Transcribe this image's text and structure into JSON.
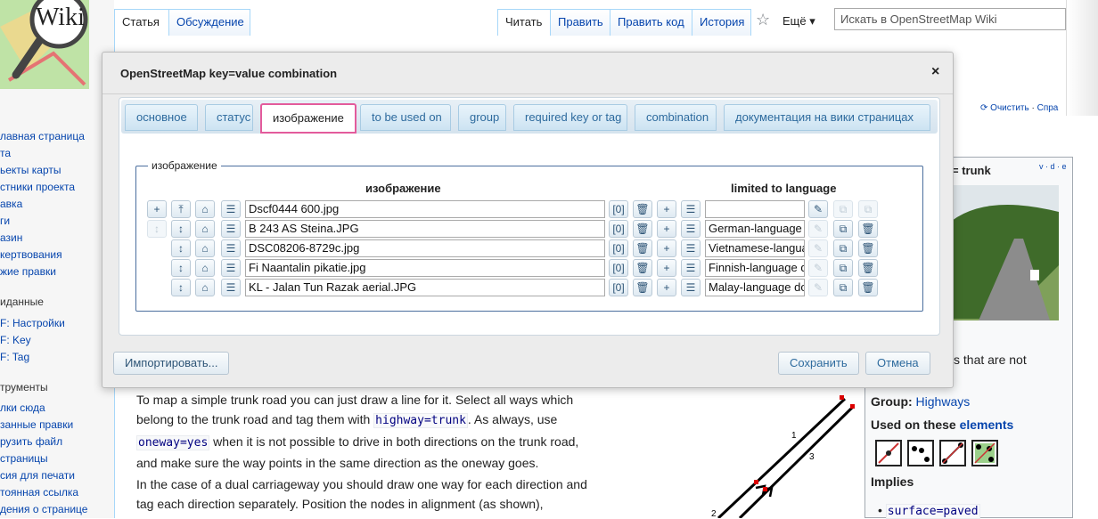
{
  "sidebar": {
    "logo_text": "Wiki",
    "nav_links": [
      "лавная страница",
      "та",
      "ьекты карты",
      "стники проекта",
      "авка",
      "ги",
      "азин",
      "кертвования",
      "жие правки"
    ],
    "section2_title": "иданные",
    "section2_links": [
      "F: Настройки",
      "F: Key",
      "F: Tag"
    ],
    "section3_title": "трументы",
    "section3_links": [
      "лки сюда",
      "занные правки",
      "рузить файл",
      "страницы",
      "сия для печати",
      "тоянная ссылка",
      "дения о странице"
    ]
  },
  "top_tabs": {
    "left": [
      "Статья",
      "Обсуждение"
    ],
    "right": [
      "Читать",
      "Править",
      "Править код",
      "История"
    ],
    "more": "Ещё"
  },
  "search": {
    "placeholder": "Искать в OpenStreetMap Wiki"
  },
  "page_tools": {
    "purge": "Очистить",
    "sep": "·",
    "help": "Спра"
  },
  "infobox": {
    "title_fragment": "= trunk",
    "vde": "v · d · e",
    "snippet": "s that are not",
    "group_label": "Group:",
    "group_value": "Highways",
    "used_on_label": "Used on these",
    "used_on_link": "elements",
    "implies_label": "Implies",
    "implies_item": "surface=paved"
  },
  "article": {
    "p1_a": "To map a simple trunk road you can just draw a line for it. Select all ways which belong to the trunk road and tag them with ",
    "p1_code1": "highway=trunk",
    "p1_b": ". As always, use ",
    "p1_code2": "oneway=yes",
    "p1_c": " when it is not possible to drive in both directions on the trunk road, and make sure the way points in the same direction as the oneway goes.",
    "p2": "In the case of a dual carriageway you should draw one way for each direction and tag each direction separately. Position the nodes in alignment (as shown),",
    "diagram_labels": [
      "1",
      "3",
      "2"
    ]
  },
  "dialog": {
    "title": "OpenStreetMap key=value combination",
    "close": "×",
    "tabs": [
      "основное",
      "статус",
      "изображение",
      "to be used on",
      "group",
      "required key or tag",
      "combination",
      "документация на вики страницах"
    ],
    "selected_tab": 2,
    "legend": "изображение",
    "col_image": "изображение",
    "col_language": "limited to language",
    "rows": [
      {
        "image": "Dscf0444 600.jpg",
        "count": "[0]",
        "language": ""
      },
      {
        "image": "B 243 AS Steina.JPG",
        "count": "[0]",
        "language": "German-language"
      },
      {
        "image": "DSC08206-8729c.jpg",
        "count": "[0]",
        "language": "Vietnamese-langua"
      },
      {
        "image": "Fi Naantalin pikatie.jpg",
        "count": "[0]",
        "language": "Finnish-language d"
      },
      {
        "image": "KL - Jalan Tun Razak aerial.JPG",
        "count": "[0]",
        "language": "Malay-language do"
      }
    ],
    "import_button": "Импортировать...",
    "save_button": "Сохранить",
    "cancel_button": "Отмена"
  },
  "icons": {
    "add": "+",
    "move_top": "⤒",
    "move": "↕",
    "tag": "⌂",
    "list": "☰",
    "delete": "🗑",
    "edit": "✎",
    "open": "⧉",
    "star": "☆",
    "chevron": "⌄"
  },
  "colors": {
    "accent": "#2e6b9e",
    "selected_tab_border": "#e35b9c",
    "link": "#0645ad"
  }
}
